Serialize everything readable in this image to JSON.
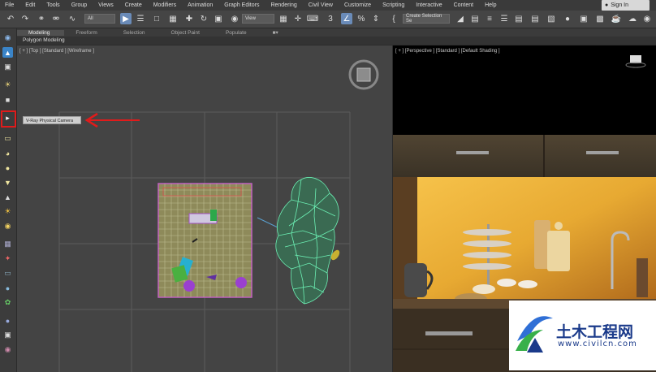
{
  "menu": [
    "File",
    "Edit",
    "Tools",
    "Group",
    "Views",
    "Create",
    "Modifiers",
    "Animation",
    "Graph Editors",
    "Rendering",
    "Civil View",
    "Customize",
    "Scripting",
    "Interactive",
    "Content",
    "Help"
  ],
  "signin": "Sign In",
  "toolbar": {
    "filter_dropdown": "All",
    "view_dropdown": "View",
    "selection_set_dropdown": "Create Selection Se"
  },
  "ribbon": {
    "tabs": [
      "Modeling",
      "Freeform",
      "Selection",
      "Object Paint",
      "Populate"
    ],
    "active_tab": "Modeling",
    "sub_label": "Polygon Modeling"
  },
  "viewports": {
    "top_label": "[ + ] [Top ] [Standard ] [Wireframe ]",
    "persp_label": "[ + ] [Perspective ] [Standard ] [Default Shading ]"
  },
  "tooltip": "V-Ray Physical Camera",
  "watermark": {
    "title": "土木工程网",
    "url": "www.civilcn.com"
  },
  "colors": {
    "highlight": "#e01b1b",
    "arrow": "#e01b1b",
    "wireframe_mesh": "#6cf0b4",
    "watermark_blue": "#1a3a8a"
  }
}
